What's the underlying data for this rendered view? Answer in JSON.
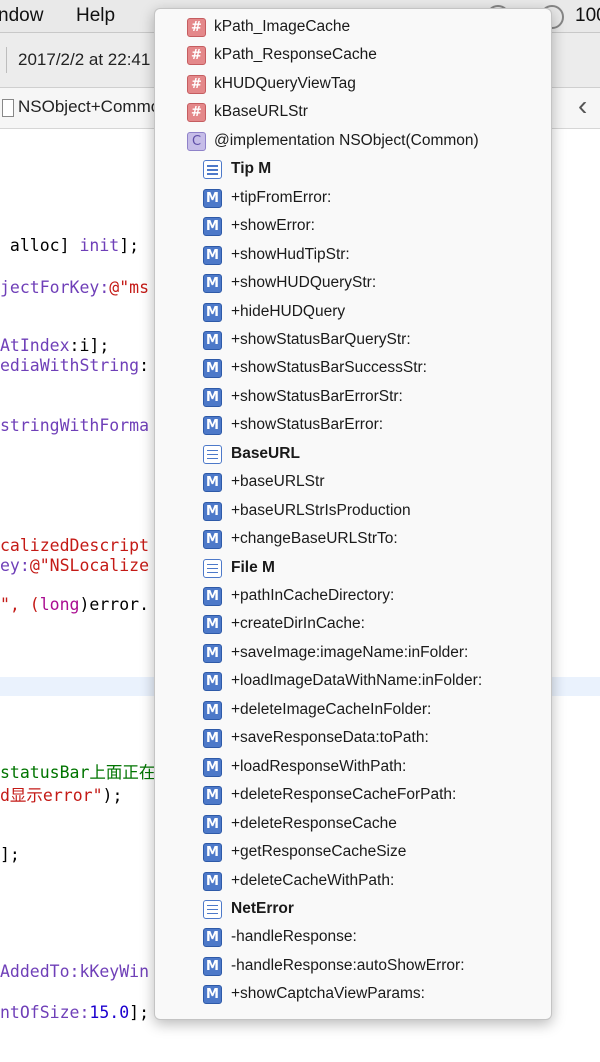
{
  "menubar": {
    "window_label": "ndow",
    "help_label": "Help",
    "status_text": "100"
  },
  "toolbar": {
    "date_text": "2017/2/2 at 22:41"
  },
  "jumpbar": {
    "file_name": "NSObject+Common",
    "back_symbol": "‹"
  },
  "code": {
    "l1a": " alloc] ",
    "l1b": "init",
    "l1c": "];",
    "l2a": "jectForKey:",
    "l2b": "@\"ms",
    "l3a": "AtIndex",
    "l3b": ":i];",
    "l4a": "ediaWithString",
    "l4b": ":",
    "l5a": "stringWithForma",
    "l6a": "calizedDescript",
    "l7a": "ey:",
    "l7b": "@\"NSLocalize",
    "l8a": "\", (",
    "l8b": "long",
    "l8c": ")error.",
    "l9a": "statusBar上面正在",
    "l10a": "d显示error\"",
    "l10b": ");",
    "l11a": "];",
    "l12a": "AddedTo:kKeyWin",
    "l13a": "ntOfSize:",
    "l13b": "15.0",
    "l13c": "];"
  },
  "popup": {
    "items": [
      {
        "kind": "hash",
        "glyph": "#",
        "label": "kPath_ImageCache"
      },
      {
        "kind": "hash",
        "glyph": "#",
        "label": "kPath_ResponseCache"
      },
      {
        "kind": "hash",
        "glyph": "#",
        "label": "kHUDQueryViewTag"
      },
      {
        "kind": "hash",
        "glyph": "#",
        "label": "kBaseURLStr"
      },
      {
        "kind": "class",
        "glyph": "C",
        "label": "@implementation NSObject(Common)"
      },
      {
        "kind": "mark",
        "label": "Tip M"
      },
      {
        "kind": "method",
        "glyph": "M",
        "label": "+tipFromError:"
      },
      {
        "kind": "method",
        "glyph": "M",
        "label": "+showError:"
      },
      {
        "kind": "method",
        "glyph": "M",
        "label": "+showHudTipStr:"
      },
      {
        "kind": "method",
        "glyph": "M",
        "label": "+showHUDQueryStr:"
      },
      {
        "kind": "method",
        "glyph": "M",
        "label": "+hideHUDQuery"
      },
      {
        "kind": "method",
        "glyph": "M",
        "label": "+showStatusBarQueryStr:"
      },
      {
        "kind": "method",
        "glyph": "M",
        "label": "+showStatusBarSuccessStr:"
      },
      {
        "kind": "method",
        "glyph": "M",
        "label": "+showStatusBarErrorStr:"
      },
      {
        "kind": "method",
        "glyph": "M",
        "label": "+showStatusBarError:"
      },
      {
        "kind": "mark",
        "label": "BaseURL"
      },
      {
        "kind": "method",
        "glyph": "M",
        "label": "+baseURLStr"
      },
      {
        "kind": "method",
        "glyph": "M",
        "label": "+baseURLStrIsProduction"
      },
      {
        "kind": "method",
        "glyph": "M",
        "label": "+changeBaseURLStrTo:"
      },
      {
        "kind": "mark",
        "label": "File M"
      },
      {
        "kind": "method",
        "glyph": "M",
        "label": "+pathInCacheDirectory:"
      },
      {
        "kind": "method",
        "glyph": "M",
        "label": "+createDirInCache:"
      },
      {
        "kind": "method",
        "glyph": "M",
        "label": "+saveImage:imageName:inFolder:"
      },
      {
        "kind": "method",
        "glyph": "M",
        "label": "+loadImageDataWithName:inFolder:"
      },
      {
        "kind": "method",
        "glyph": "M",
        "label": "+deleteImageCacheInFolder:"
      },
      {
        "kind": "method",
        "glyph": "M",
        "label": "+saveResponseData:toPath:"
      },
      {
        "kind": "method",
        "glyph": "M",
        "label": "+loadResponseWithPath:"
      },
      {
        "kind": "method",
        "glyph": "M",
        "label": "+deleteResponseCacheForPath:"
      },
      {
        "kind": "method",
        "glyph": "M",
        "label": "+deleteResponseCache"
      },
      {
        "kind": "method",
        "glyph": "M",
        "label": "+getResponseCacheSize"
      },
      {
        "kind": "method",
        "glyph": "M",
        "label": "+deleteCacheWithPath:"
      },
      {
        "kind": "mark",
        "label": "NetError"
      },
      {
        "kind": "method",
        "glyph": "M",
        "label": "-handleResponse:"
      },
      {
        "kind": "method",
        "glyph": "M",
        "label": "-handleResponse:autoShowError:"
      },
      {
        "kind": "method",
        "glyph": "M",
        "label": "+showCaptchaViewParams:"
      }
    ]
  }
}
